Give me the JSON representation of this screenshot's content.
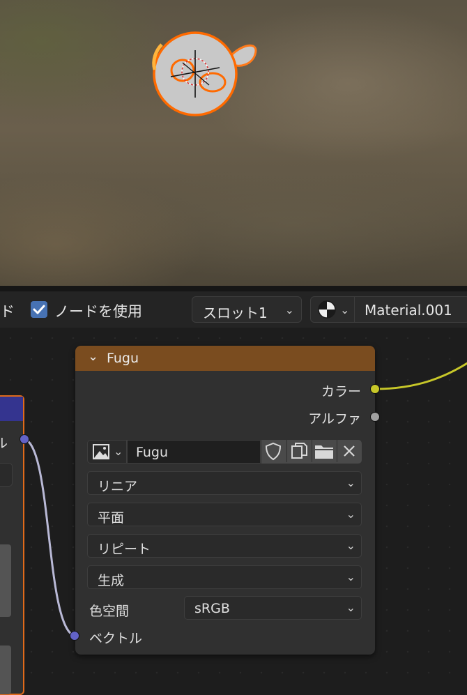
{
  "header": {
    "partial_label": "ド",
    "use_nodes_label": "ノードを使用",
    "use_nodes_checked": true,
    "slot_label": "スロット1",
    "material_name": "Material.001"
  },
  "left_node": {
    "partial_socket_label": "ル"
  },
  "image_node": {
    "title": "Fugu",
    "outputs": {
      "color": "カラー",
      "alpha": "アルファ"
    },
    "image_name": "Fugu",
    "interpolation": "リニア",
    "projection": "平面",
    "extension": "リピート",
    "source": "生成",
    "color_space_label": "色空間",
    "color_space_value": "sRGB",
    "vector_input": "ベクトル"
  },
  "colors": {
    "node_header": "#7a4c1f",
    "selection_outline": "#e06a1a",
    "color_socket": "#c7c729",
    "vector_socket": "#6363c7",
    "float_socket": "#a1a1a1",
    "checkbox": "#4772b3"
  }
}
